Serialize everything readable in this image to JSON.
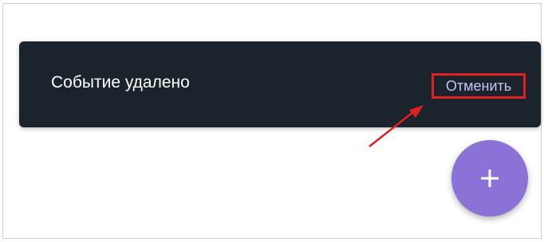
{
  "snackbar": {
    "message": "Событие удалено",
    "action_label": "Отменить"
  },
  "fab": {
    "icon": "plus-icon"
  },
  "annotation": {
    "highlight_color": "#e02020"
  },
  "colors": {
    "snackbar_bg": "#1b232c",
    "action_text": "#c9c2f2",
    "fab_bg": "#8a72d6"
  }
}
